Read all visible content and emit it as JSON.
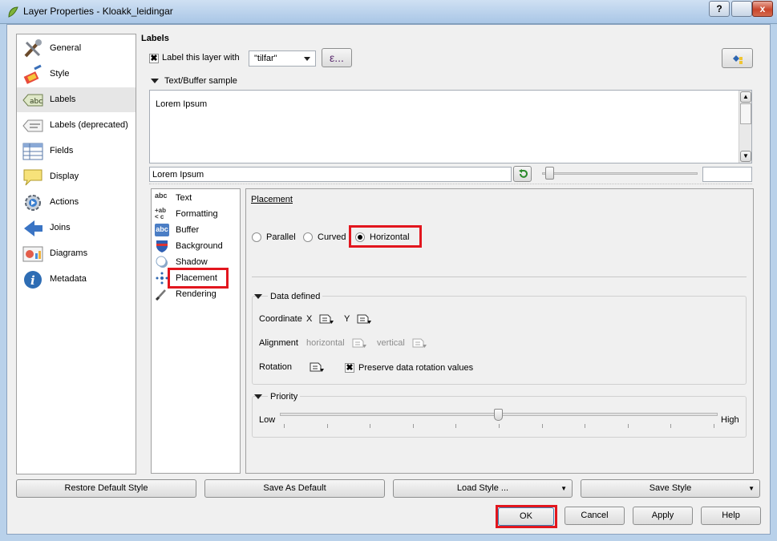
{
  "window": {
    "title": "Layer Properties - Kloakk_leidingar",
    "help_btn": "?",
    "minimize_btn": "_",
    "close_btn": "x"
  },
  "nav": {
    "items": [
      {
        "label": "General",
        "icon": "tools-icon"
      },
      {
        "label": "Style",
        "icon": "paintbrush-icon"
      },
      {
        "label": "Labels",
        "icon": "abc-label-icon",
        "selected": true
      },
      {
        "label": "Labels (deprecated)",
        "icon": "label-deprecated-icon"
      },
      {
        "label": "Fields",
        "icon": "table-icon"
      },
      {
        "label": "Display",
        "icon": "speech-bubble-icon"
      },
      {
        "label": "Actions",
        "icon": "gear-icon"
      },
      {
        "label": "Joins",
        "icon": "join-icon"
      },
      {
        "label": "Diagrams",
        "icon": "diagram-icon"
      },
      {
        "label": "Metadata",
        "icon": "info-icon"
      }
    ]
  },
  "labels": {
    "heading": "Labels",
    "label_this_layer": "Label this layer with",
    "label_this_layer_checked": true,
    "field_value": "\"tilfar\"",
    "expression_btn": "ε...",
    "sample_header": "Text/Buffer sample",
    "sample_text": "Lorem Ipsum",
    "sample_input": "Lorem Ipsum"
  },
  "subnav": {
    "items": [
      {
        "label": "Text",
        "icon": "abc"
      },
      {
        "label": "Formatting",
        "icon": "+ab"
      },
      {
        "label": "Buffer",
        "icon": "abc"
      },
      {
        "label": "Background",
        "icon": "shield"
      },
      {
        "label": "Shadow",
        "icon": "shadow"
      },
      {
        "label": "Placement",
        "icon": "placement"
      },
      {
        "label": "Rendering",
        "icon": "brush"
      }
    ]
  },
  "placement": {
    "title": "Placement",
    "options": [
      "Parallel",
      "Curved",
      "Horizontal"
    ],
    "selected": "Horizontal"
  },
  "data_defined": {
    "title": "Data defined",
    "coordinate": "Coordinate",
    "x": "X",
    "y": "Y",
    "alignment": "Alignment",
    "horizontal": "horizontal",
    "vertical": "vertical",
    "rotation": "Rotation",
    "preserve": "Preserve data rotation values",
    "preserve_checked": true
  },
  "priority": {
    "title": "Priority",
    "low": "Low",
    "high": "High",
    "level": 0.5
  },
  "bottom": {
    "restore": "Restore Default Style",
    "save_default": "Save As Default",
    "load_style": "Load Style ...",
    "save_style": "Save Style",
    "ok": "OK",
    "cancel": "Cancel",
    "apply": "Apply",
    "help": "Help"
  },
  "colors": {
    "highlight": "#e2161e",
    "selected_nav": "#e6e6e6"
  }
}
